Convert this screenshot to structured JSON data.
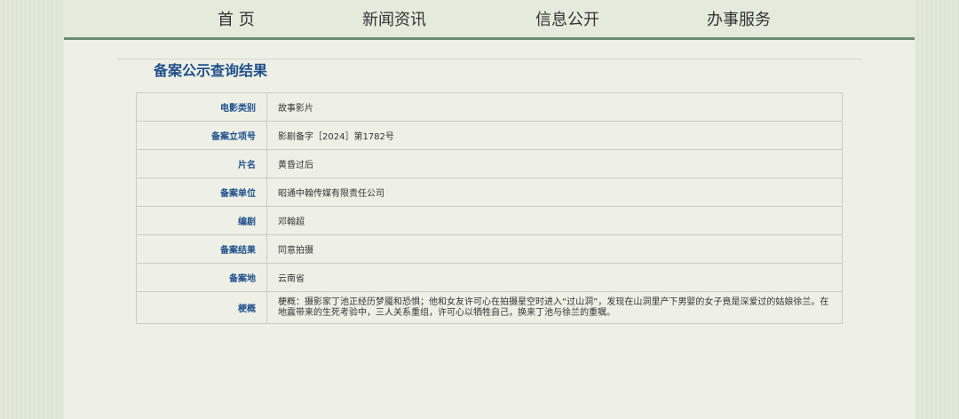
{
  "nav": {
    "items": [
      "首 页",
      "新闻资讯",
      "信息公开",
      "办事服务"
    ]
  },
  "section_title": "备案公示查询结果",
  "record": [
    {
      "label": "电影类别",
      "value": "故事影片"
    },
    {
      "label": "备案立项号",
      "value": "影剧备字［2024］第1782号"
    },
    {
      "label": "片名",
      "value": "黄昏过后"
    },
    {
      "label": "备案单位",
      "value": "昭通中翰传媒有限责任公司"
    },
    {
      "label": "编剧",
      "value": "邓翰超"
    },
    {
      "label": "备案结果",
      "value": "同意拍摄"
    },
    {
      "label": "备案地",
      "value": "云南省"
    },
    {
      "label": "梗概",
      "value": "梗概：摄影家丁池正经历梦魇和恐惧；他和女友许可心在拍摄星空时进入“过山洞”，发现在山洞里产下男婴的女子竟是深爱过的姑娘徐兰。在地震带来的生死考验中，三人关系重组，许可心以牺牲自己，换来丁池与徐兰的重嘱。"
    }
  ],
  "colors": {
    "accent": "#1f4f8b",
    "nav_border": "#6e8b74",
    "background": "#dfe8d9",
    "panel": "#eef0e6"
  }
}
